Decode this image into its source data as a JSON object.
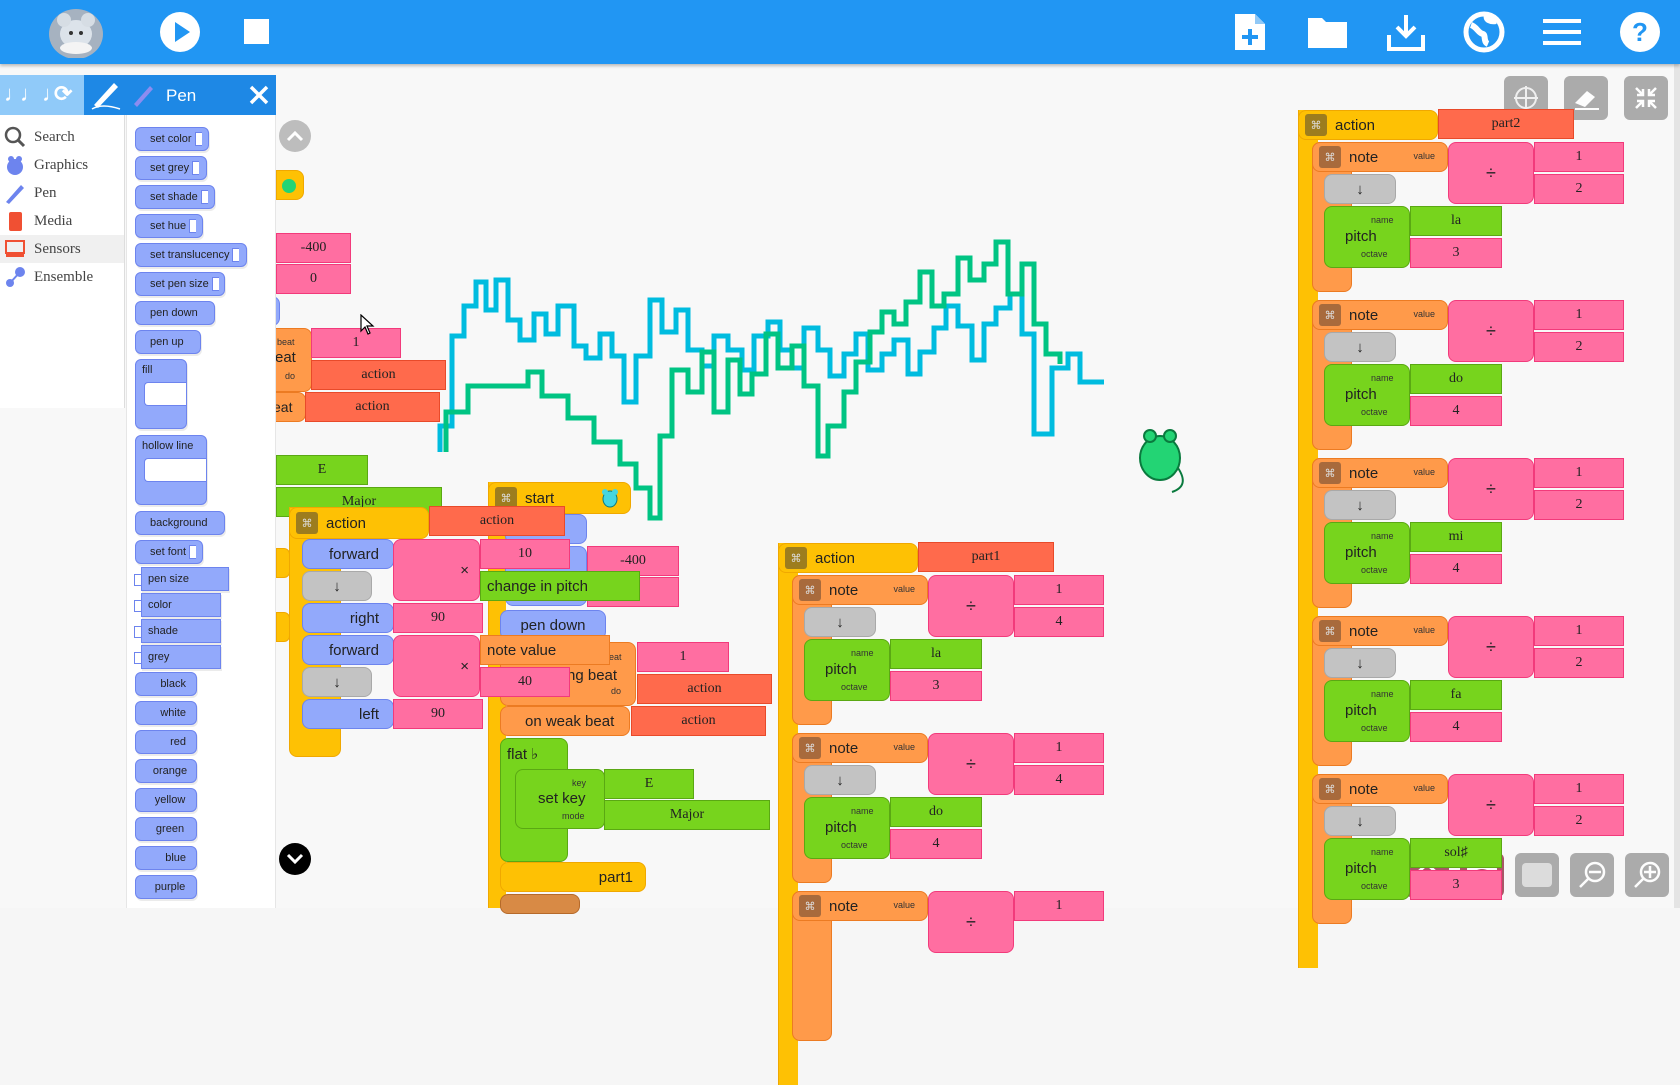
{
  "topbar": {
    "logo": "mouse-logo",
    "left_buttons": [
      "play-icon",
      "stop-icon"
    ],
    "right_buttons": [
      "new-file-icon",
      "open-folder-icon",
      "save-download-icon",
      "planet-globe-icon",
      "menu-icon",
      "help-icon"
    ]
  },
  "palette": {
    "tab_icons": [
      "music-notes-icon",
      "rhythm-notes-icon",
      "flow-refresh-icon",
      "art-pen-icon"
    ],
    "title": "Pen",
    "close_icon": "close-icon",
    "categories": [
      {
        "label": "Search",
        "icon": "search-icon"
      },
      {
        "label": "Graphics",
        "icon": "turtle-icon"
      },
      {
        "label": "Pen",
        "icon": "pen-icon"
      },
      {
        "label": "Media",
        "icon": "notebook-icon"
      },
      {
        "label": "Sensors",
        "icon": "monitor-icon"
      },
      {
        "label": "Ensemble",
        "icon": "ensemble-icon"
      }
    ],
    "selected_category": "Sensors",
    "blocks": [
      "set color",
      "set grey",
      "set shade",
      "set hue",
      "set translucency",
      "set pen size",
      "pen down",
      "pen up",
      "fill",
      "hollow line",
      "background",
      "set font",
      "pen size",
      "color",
      "shade",
      "grey",
      "black",
      "white",
      "red",
      "orange",
      "yellow",
      "green",
      "blue",
      "purple"
    ]
  },
  "canvas": {
    "left_stack": {
      "values": [
        "-400",
        "0",
        "1",
        "action",
        "action",
        "E",
        "Major"
      ],
      "labels": {
        "beat": "beat",
        "repeat_frag": "eat",
        "do": "do",
        "beat_frag": "eat"
      }
    },
    "action_block": {
      "title": "action",
      "name": "action",
      "steps": [
        {
          "cmd": "forward",
          "op": "×",
          "args": [
            "10",
            "change in pitch"
          ]
        },
        {
          "cmd": "↓"
        },
        {
          "cmd": "right",
          "arg": "90"
        },
        {
          "cmd": "forward",
          "op": "×",
          "args": [
            "note value",
            "40"
          ]
        },
        {
          "cmd": "↓"
        },
        {
          "cmd": "left",
          "arg": "90"
        }
      ]
    },
    "start_block": {
      "title": "start",
      "setxy_values": [
        "-400",
        ""
      ],
      "pen_down": "pen down",
      "on_strong_beat": {
        "label": "ng beat",
        "beat_label": "eat",
        "do_label": "do",
        "beat": "1",
        "action": "action"
      },
      "on_weak_beat": {
        "label": "on weak beat",
        "action": "action"
      },
      "flat": "flat ♭",
      "set_key": {
        "label": "set key",
        "key_label": "key",
        "mode_label": "mode",
        "key": "E",
        "mode": "Major"
      },
      "do_action": "part1",
      "frag_top": "p"
    },
    "part1_block": {
      "title": "action",
      "name": "part1",
      "notes": [
        {
          "value_num": "1",
          "value_den": "4",
          "pitch": "la",
          "octave": "3"
        },
        {
          "value_num": "1",
          "value_den": "4",
          "pitch": "do",
          "octave": "4"
        },
        {
          "value_num": "1",
          "value_den": "",
          "pitch": "",
          "octave": ""
        }
      ]
    },
    "part2_block": {
      "title": "action",
      "name": "part2",
      "notes": [
        {
          "value_num": "1",
          "value_den": "2",
          "pitch": "la",
          "octave": "3"
        },
        {
          "value_num": "1",
          "value_den": "2",
          "pitch": "do",
          "octave": "4"
        },
        {
          "value_num": "1",
          "value_den": "2",
          "pitch": "mi",
          "octave": "4"
        },
        {
          "value_num": "1",
          "value_den": "2",
          "pitch": "fa",
          "octave": "4"
        },
        {
          "value_num": "1",
          "value_den": "2",
          "pitch": "sol♯",
          "octave": "3"
        }
      ]
    },
    "note_labels": {
      "note": "note",
      "value": "value",
      "pitch": "pitch",
      "name": "name",
      "octave": "octave",
      "down": "↓",
      "divide": "÷"
    },
    "trace_colors": {
      "cyan": "#00bcdf",
      "green": "#00c483"
    }
  },
  "right_tools": [
    "grid-icon",
    "eraser-clear-icon",
    "collapse-icon"
  ],
  "bottom_tools": [
    "home-icon",
    "show-hide-blocks-icon",
    "expand-collapse-icon",
    "zoom-out-icon",
    "zoom-in-icon"
  ]
}
